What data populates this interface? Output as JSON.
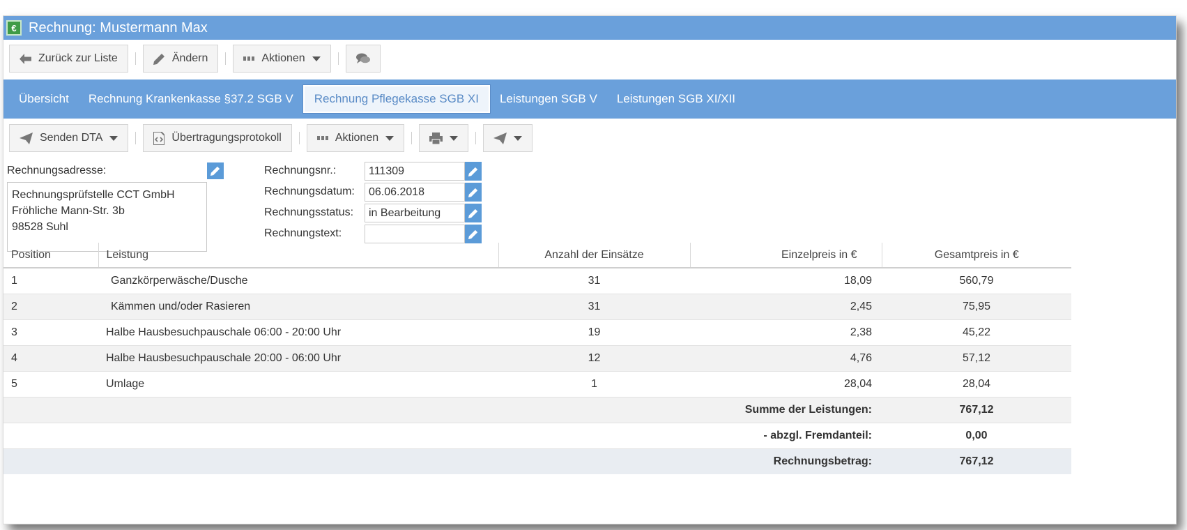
{
  "window": {
    "title": "Rechnung: Mustermann Max",
    "app_icon_text": "€"
  },
  "toolbar": {
    "back_label": "Zurück zur Liste",
    "edit_label": "Ändern",
    "actions_label": "Aktionen"
  },
  "tabs": [
    {
      "label": "Übersicht"
    },
    {
      "label": "Rechnung Krankenkasse §37.2 SGB V"
    },
    {
      "label": "Rechnung Pflegekasse SGB XI"
    },
    {
      "label": "Leistungen SGB V"
    },
    {
      "label": "Leistungen SGB XI/XII"
    }
  ],
  "active_tab": "Rechnung Pflegekasse SGB XI",
  "subtoolbar": {
    "send_dta_label": "Senden DTA",
    "protocol_label": "Übertragungsprotokoll",
    "actions_label": "Aktionen"
  },
  "invoice": {
    "address_label": "Rechnungsadresse:",
    "address_lines": [
      "Rechnungsprüfstelle CCT GmbH",
      "Fröhliche Mann-Str. 3b",
      "98528 Suhl"
    ],
    "number_label": "Rechnungsnr.:",
    "number_value": "111309",
    "date_label": "Rechnungsdatum:",
    "date_value": "06.06.2018",
    "status_label": "Rechnungsstatus:",
    "status_value": "in Bearbeitung",
    "text_label": "Rechnungstext:",
    "text_value": ""
  },
  "table": {
    "headers": [
      "Position",
      "Leistung",
      "Anzahl der Einsätze",
      "Einzelpreis in €",
      "Gesamtpreis in €"
    ],
    "rows": [
      [
        "1",
        " Ganzkörperwäsche/Dusche",
        "31",
        "18,09",
        "560,79"
      ],
      [
        "2",
        " Kämmen und/oder Rasieren",
        "31",
        "2,45",
        "75,95"
      ],
      [
        "3",
        "Halbe Hausbesuchpauschale 06:00 - 20:00 Uhr",
        "19",
        "2,38",
        "45,22"
      ],
      [
        "4",
        "Halbe Hausbesuchpauschale 20:00 - 06:00 Uhr",
        "12",
        "4,76",
        "57,12"
      ],
      [
        "5",
        "Umlage",
        "1",
        "28,04",
        "28,04"
      ]
    ],
    "sum_label": "Summe der Leistungen:",
    "sum_value": "767,12",
    "deduction_label": "- abzgl. Fremdanteil:",
    "deduction_value": "0,00",
    "total_label": "Rechnungsbetrag:",
    "total_value": "767,12"
  },
  "colors": {
    "accent": "#6aa0db",
    "edit_button": "#5b9bd8"
  }
}
